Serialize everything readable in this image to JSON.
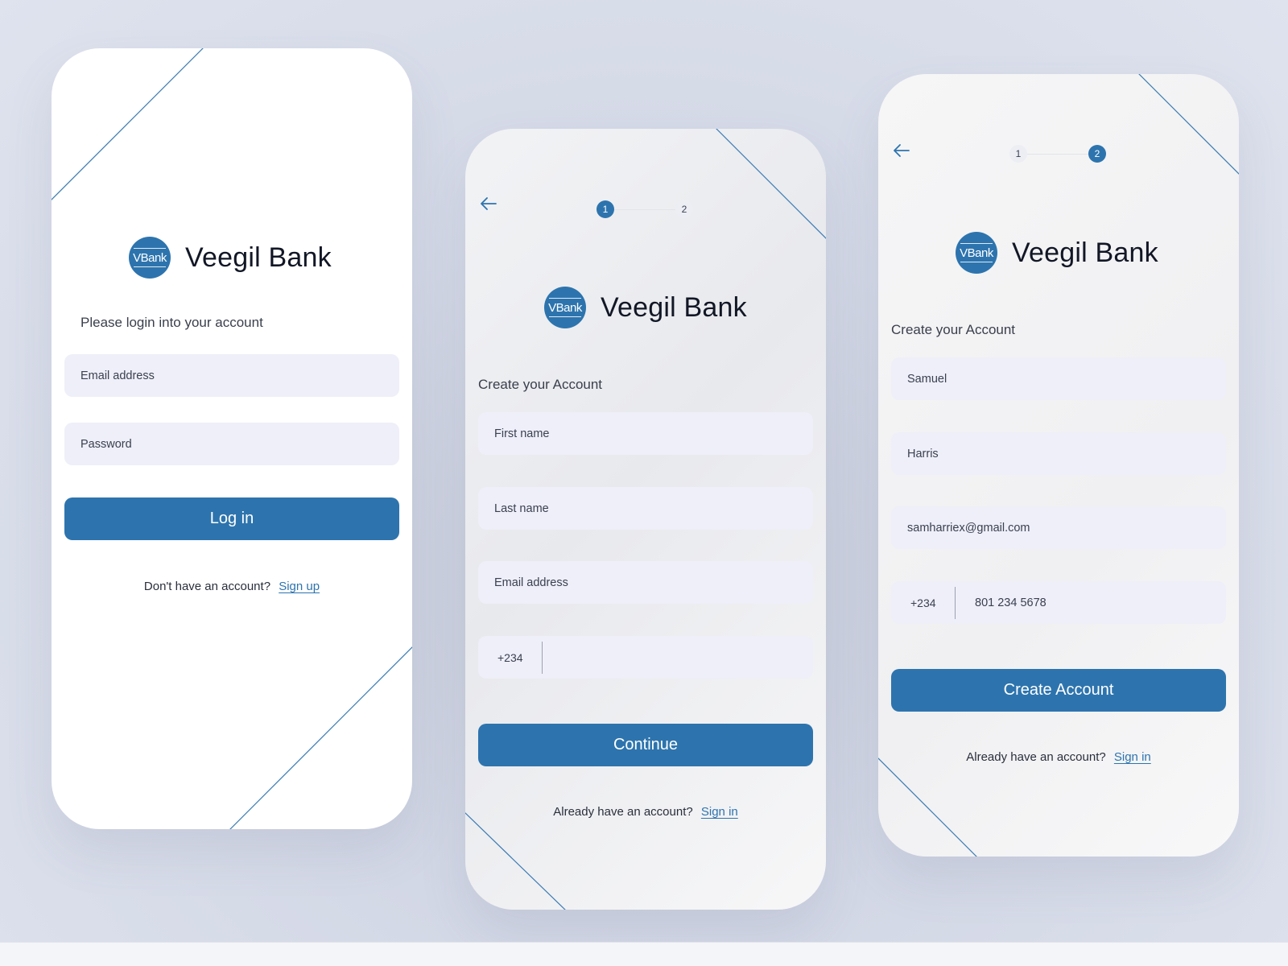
{
  "brand": {
    "logo_text": "VBank",
    "name": "Veegil Bank"
  },
  "colors": {
    "accent": "#2d74ae",
    "field_bg": "#eeeff8",
    "text": "#121726"
  },
  "icons": {
    "back": "arrow-left-icon"
  },
  "login": {
    "subtitle": "Please login into your account",
    "email_placeholder": "Email address",
    "password_placeholder": "Password",
    "login_label": "Log in",
    "footer_text": "Don't have an account?",
    "footer_link": "Sign up"
  },
  "signup_step1": {
    "steps": [
      "1",
      "2"
    ],
    "active_step": 1,
    "subtitle": "Create your Account",
    "first_name_placeholder": "First name",
    "last_name_placeholder": "Last name",
    "email_placeholder": "Email address",
    "country_code": "+234",
    "phone_value": "",
    "continue_label": "Continue",
    "footer_text": "Already have an account?",
    "footer_link": "Sign  in"
  },
  "signup_step2": {
    "steps": [
      "1",
      "2"
    ],
    "active_step": 2,
    "subtitle": "Create your Account",
    "first_name_value": "Samuel",
    "last_name_value": "Harris",
    "email_value": "samharriex@gmail.com",
    "country_code": "+234",
    "phone_value": "801 234 5678",
    "create_label": "Create Account",
    "footer_text": "Already have an account?",
    "footer_link": "Sign  in"
  }
}
